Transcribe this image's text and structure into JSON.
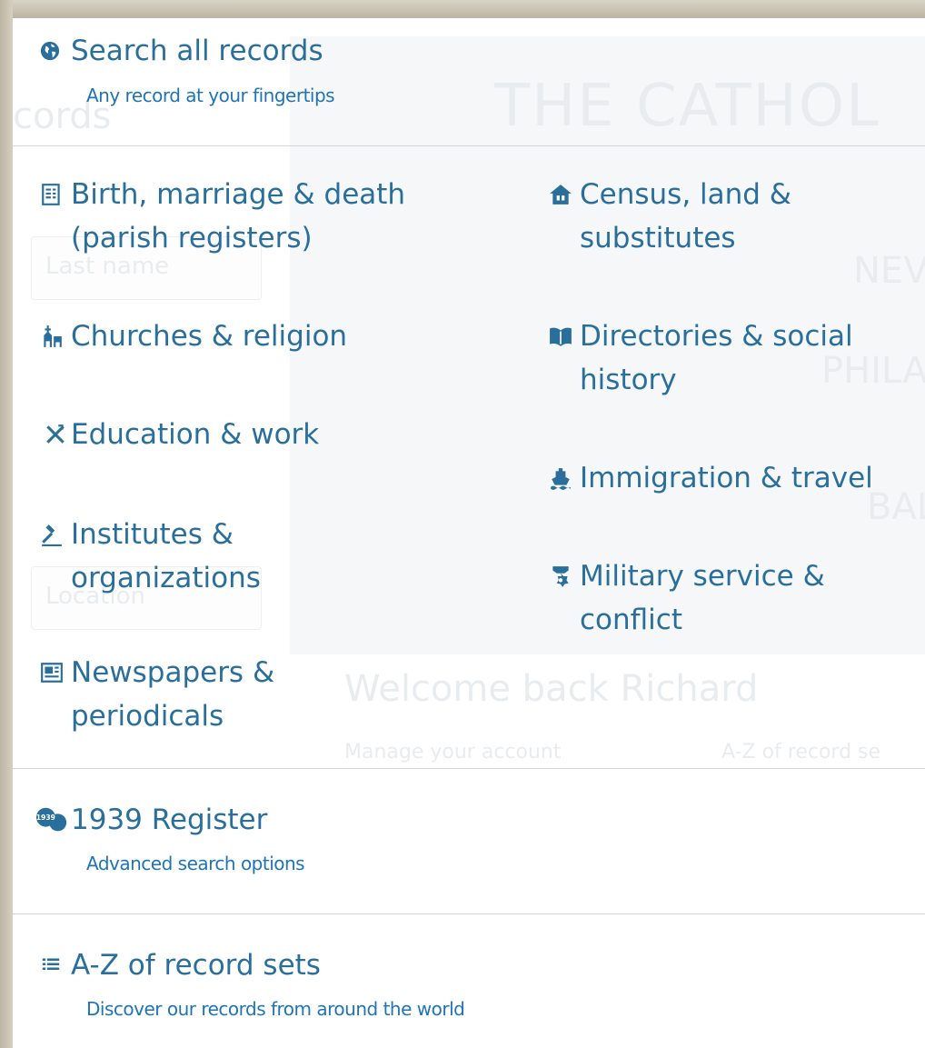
{
  "menu": {
    "search_all": {
      "label": "Search all records",
      "sub": "Any record at your fingertips",
      "icon": "globe-icon"
    },
    "categories_left": [
      {
        "label": "Birth, marriage & death\n(parish registers)",
        "icon": "register-icon"
      },
      {
        "label": "Churches & religion",
        "icon": "church-icon"
      },
      {
        "label": "Education & work",
        "icon": "tools-icon"
      },
      {
        "label": "Institutes &\norganizations",
        "icon": "gavel-icon"
      },
      {
        "label": "Newspapers &\nperiodicals",
        "icon": "newspaper-icon"
      }
    ],
    "categories_right": [
      {
        "label": "Census, land &\nsubstitutes",
        "icon": "house-icon"
      },
      {
        "label": "Directories & social\nhistory",
        "icon": "book-icon"
      },
      {
        "label": "Immigration & travel",
        "icon": "ship-icon"
      },
      {
        "label": "Military service &\nconflict",
        "icon": "medal-icon"
      }
    ],
    "register_1939": {
      "label": "1939 Register",
      "sub": "Advanced search options",
      "icon": "badge-1939-icon",
      "badge_text": "1939"
    },
    "az": {
      "label": "A-Z of record sets",
      "sub": "Discover our records from around the world",
      "icon": "list-icon"
    }
  },
  "background": {
    "heading": "cords",
    "banner": "THE CATHOL",
    "last_name_placeholder": "Last name",
    "location_placeholder": "Location",
    "arch1": "NEV",
    "arch2": "PHILA",
    "arch3": "BAL",
    "welcome": "Welcome back Richard",
    "manage": "Manage your account",
    "az_link": "A-Z of record se"
  },
  "colors": {
    "link": "#2a6f9b",
    "sub_link": "#1f74b5",
    "divider": "#d2d6da"
  }
}
